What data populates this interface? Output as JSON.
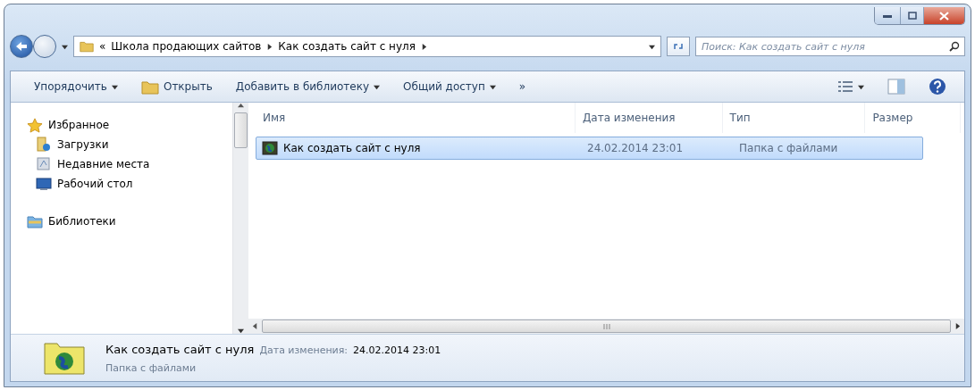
{
  "address": {
    "separator": "«",
    "crumbs": [
      "Школа продающих сайтов",
      "Как создать сайт с нуля"
    ]
  },
  "search": {
    "placeholder": "Поиск: Как создать сайт с нуля"
  },
  "toolbar": {
    "items": [
      {
        "label": "Упорядочить",
        "kind": "menu"
      },
      {
        "label": "Открыть",
        "kind": "open"
      },
      {
        "label": "Добавить в библиотеку",
        "kind": "menu"
      },
      {
        "label": "Общий доступ",
        "kind": "menu"
      }
    ],
    "overflow": "»"
  },
  "nav": {
    "groups": [
      {
        "label": "Избранное",
        "kind": "star",
        "children": [
          {
            "label": "Загрузки",
            "kind": "downloads"
          },
          {
            "label": "Недавние места",
            "kind": "recent"
          },
          {
            "label": "Рабочий стол",
            "kind": "desktop"
          }
        ]
      },
      {
        "label": "Библиотеки",
        "kind": "library"
      }
    ]
  },
  "columns": [
    "Имя",
    "Дата изменения",
    "Тип",
    "Размер"
  ],
  "rows": [
    {
      "name": "Как создать сайт с нуля",
      "date": "24.02.2014 23:01",
      "type": "Папка с файлами",
      "selected": true
    }
  ],
  "details": {
    "name": "Как создать сайт с нуля",
    "date_label": "Дата изменения:",
    "date": "24.02.2014 23:01",
    "type": "Папка с файлами"
  }
}
